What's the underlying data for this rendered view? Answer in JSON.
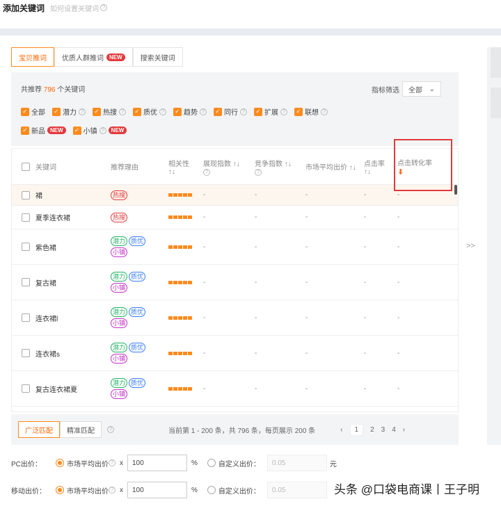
{
  "header": {
    "title": "添加关键词",
    "help": "如何设置关键词"
  },
  "tabs": [
    {
      "label": "宝贝推词",
      "active": true
    },
    {
      "label": "优质人群推词",
      "badge": "NEW"
    },
    {
      "label": "搜索关键词"
    }
  ],
  "summary": {
    "prefix": "共推荐",
    "count": "796",
    "suffix": "个关键词"
  },
  "index_filter": {
    "label": "指标筛选",
    "value": "全部"
  },
  "filters_row1": [
    "全部",
    "潜力",
    "热搜",
    "质优",
    "趋势",
    "同行",
    "扩展",
    "联想"
  ],
  "filters_row2": [
    "新品",
    "小镇"
  ],
  "new_badge": "NEW",
  "table": {
    "headers": {
      "keyword": "关键词",
      "reason": "推荐理由",
      "relevance": "相关性",
      "impressions": "展现指数",
      "competition": "竞争指数",
      "avg_bid": "市场平均出价",
      "ctr": "点击率",
      "cvr": "点击转化率"
    },
    "rows": [
      {
        "kw": "裙",
        "tags": [
          "热搜"
        ]
      },
      {
        "kw": "夏季连衣裙",
        "tags": [
          "热搜"
        ]
      },
      {
        "kw": "紫色裙",
        "tags": [
          "潜力",
          "质优",
          "小镇"
        ]
      },
      {
        "kw": "复古裙",
        "tags": [
          "潜力",
          "质优",
          "小镇"
        ]
      },
      {
        "kw": "连衣裙l",
        "tags": [
          "潜力",
          "质优",
          "小镇"
        ]
      },
      {
        "kw": "连衣裙s",
        "tags": [
          "潜力",
          "质优",
          "小镇"
        ]
      },
      {
        "kw": "复古连衣裙夏",
        "tags": [
          "潜力",
          "质优",
          "小镇"
        ]
      }
    ],
    "empty_value": "-"
  },
  "footer": {
    "broad": "广泛匹配",
    "exact": "精准匹配",
    "pager_text": "当前第 1 - 200 条，共 796 条，每页展示 200 条",
    "pages": [
      "1",
      "2",
      "3",
      "4"
    ]
  },
  "pc_bid": {
    "label": "PC出价：",
    "option1": "市场平均出价",
    "mult": "x",
    "value": "100",
    "unit": "%",
    "option2": "自定义出价：",
    "custom": "0.05",
    "currency": "元"
  },
  "mobile_bid": {
    "label": "移动出价：",
    "option1": "市场平均出价",
    "mult": "x",
    "value": "100",
    "unit": "%",
    "option2": "自定义出价：",
    "custom": "0.05"
  },
  "expand_label": ">>",
  "watermark": "头条 @口袋电商课丨王子明"
}
